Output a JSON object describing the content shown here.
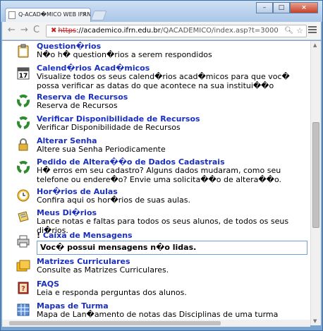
{
  "browser": {
    "tab_title": "Q-ACAD�MICO WEB IFRN",
    "tab_close": "×",
    "url_scheme": "https",
    "url_host": "://academico.ifrn.edu.br",
    "url_path": "/QACADEMICO/index.asp?t=3000",
    "nav_back": "←",
    "nav_forward": "→",
    "nav_reload": "C",
    "win_minimize": "–",
    "win_maximize": "□",
    "win_close": "×"
  },
  "items": [
    {
      "title": "Question�rios",
      "desc": "N�o h� question�rios a serem respondidos",
      "icon": "clipboard-icon"
    },
    {
      "title": "Calend�rios Acad�micos",
      "desc": "Visualize todos os seus calend�rios acad�micos para que voc� possa verificar as datas do que acontece na sua institui��o",
      "icon": "calendar-icon"
    },
    {
      "title": "Reserva de Recursos",
      "desc": "Reserva de Recursos",
      "icon": "recycle-icon"
    },
    {
      "title": "Verificar Disponibilidade de Recursos",
      "desc": "Verificar Disponibilidade de Recursos",
      "icon": "recycle-icon"
    },
    {
      "title": "Alterar Senha",
      "desc": "Altere sua Senha Periodicamente",
      "icon": "padlock-icon"
    },
    {
      "title": "Pedido de Altera��o de Dados Cadastrais",
      "desc": "H� erros em seu cadastro? Alguns dados mudaram, como seu telefone ou endere�o? Envie uma solicita��o de altera��o.",
      "icon": "recycle-icon"
    },
    {
      "title": "Hor�rios de Aulas",
      "desc": "Confira aqui os hor�rios de suas aulas.",
      "icon": "clock-icon"
    },
    {
      "title": "Meus Di�rios",
      "desc": "Lance notas e faltas para todos os seus alunos, de todos os seus di�rios.",
      "icon": "notebook-icon"
    },
    {
      "title": "Caixa de Mensagens",
      "desc": "Voc� possui mensagens n�o lidas.",
      "icon": "printer-icon",
      "warn": "!"
    },
    {
      "title": "Matrizes Curriculares",
      "desc": "Consulte as Matrizes Curriculares.",
      "icon": "folders-icon"
    },
    {
      "title": "FAQS",
      "desc": "Leia e responda perguntas dos alunos.",
      "icon": "help-book-icon"
    },
    {
      "title": "Mapas de Turma",
      "desc": "Mapa de Lan�amento de notas das Disciplinas de uma turma",
      "icon": "grid-icon"
    }
  ],
  "colors": {
    "link": "#1a2fbf",
    "frame": "#7aa3cf",
    "message_border": "#6f9fd8"
  }
}
